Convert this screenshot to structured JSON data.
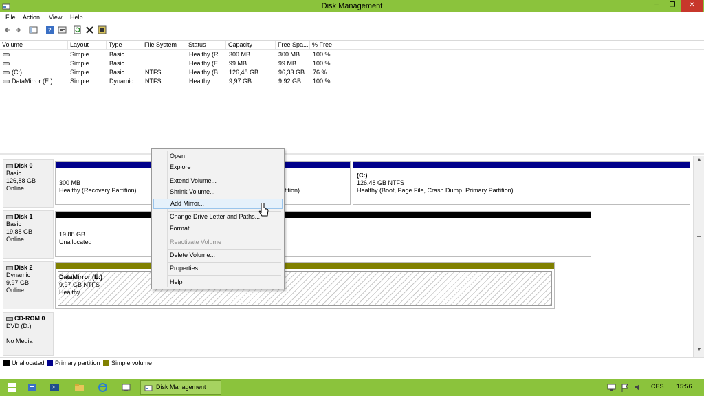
{
  "window": {
    "title": "Disk Management"
  },
  "menubar": {
    "items": [
      "File",
      "Action",
      "View",
      "Help"
    ]
  },
  "columns": [
    "Volume",
    "Layout",
    "Type",
    "File System",
    "Status",
    "Capacity",
    "Free Spa...",
    "% Free"
  ],
  "volumes": [
    {
      "volume": "",
      "layout": "Simple",
      "type": "Basic",
      "fs": "",
      "status": "Healthy (R...",
      "capacity": "300 MB",
      "free": "300 MB",
      "pct": "100 %"
    },
    {
      "volume": "",
      "layout": "Simple",
      "type": "Basic",
      "fs": "",
      "status": "Healthy (E...",
      "capacity": "99 MB",
      "free": "99 MB",
      "pct": "100 %"
    },
    {
      "volume": "(C:)",
      "layout": "Simple",
      "type": "Basic",
      "fs": "NTFS",
      "status": "Healthy (B...",
      "capacity": "126,48 GB",
      "free": "96,33 GB",
      "pct": "76 %"
    },
    {
      "volume": "DataMirror (E:)",
      "layout": "Simple",
      "type": "Dynamic",
      "fs": "NTFS",
      "status": "Healthy",
      "capacity": "9,97 GB",
      "free": "9,92 GB",
      "pct": "100 %"
    }
  ],
  "disks": {
    "disk0": {
      "name": "Disk 0",
      "kind": "Basic",
      "size": "126,88 GB",
      "state": "Online",
      "p1": {
        "size": "300 MB",
        "status": "Healthy (Recovery Partition)"
      },
      "p2": {
        "status_tail": "tition)"
      },
      "p3": {
        "title": "(C:)",
        "size": "126,48 GB NTFS",
        "status": "Healthy (Boot, Page File, Crash Dump, Primary Partition)"
      }
    },
    "disk1": {
      "name": "Disk 1",
      "kind": "Basic",
      "size": "19,88 GB",
      "state": "Online",
      "p1": {
        "size": "19,88 GB",
        "status": "Unallocated"
      }
    },
    "disk2": {
      "name": "Disk 2",
      "kind": "Dynamic",
      "size": "9,97 GB",
      "state": "Online",
      "p1": {
        "title": "DataMirror  (E:)",
        "size": "9,97 GB NTFS",
        "status": "Healthy"
      }
    },
    "cdrom": {
      "name": "CD-ROM 0",
      "kind": "DVD (D:)",
      "state": "No Media"
    }
  },
  "legend": {
    "unallocated": "Unallocated",
    "primary": "Primary partition",
    "simple": "Simple volume"
  },
  "context_menu": {
    "open": "Open",
    "explore": "Explore",
    "extend": "Extend Volume...",
    "shrink": "Shrink Volume...",
    "add_mirror": "Add Mirror...",
    "change_letter": "Change Drive Letter and Paths...",
    "format": "Format...",
    "reactivate": "Reactivate Volume",
    "delete": "Delete Volume...",
    "properties": "Properties",
    "help": "Help"
  },
  "taskbar": {
    "task": "Disk Management",
    "lang": "CES",
    "time": "15:56"
  },
  "colors": {
    "accent": "#8bc33c",
    "primary": "#00008b",
    "unallocated": "#000000",
    "simple": "#808000"
  }
}
